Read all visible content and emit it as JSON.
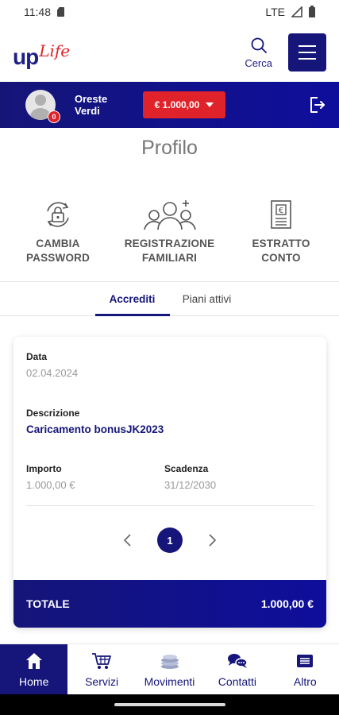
{
  "status_bar": {
    "time": "11:48",
    "network": "LTE"
  },
  "header": {
    "logo_up": "up",
    "logo_life": "Life",
    "search_label": "Cerca"
  },
  "user": {
    "first_name": "Oreste",
    "last_name": "Verdi",
    "notifications": "0",
    "balance": "€ 1.000,00"
  },
  "page_title": "Profilo",
  "actions": [
    {
      "line1": "CAMBIA",
      "line2": "PASSWORD",
      "icon": "lock-refresh-icon"
    },
    {
      "line1": "REGISTRAZIONE",
      "line2": "FAMILIARI",
      "icon": "family-add-icon"
    },
    {
      "line1": "ESTRATTO",
      "line2": "CONTO",
      "icon": "euro-document-icon"
    }
  ],
  "tabs": [
    {
      "label": "Accrediti",
      "active": true
    },
    {
      "label": "Piani attivi",
      "active": false
    }
  ],
  "card": {
    "date_label": "Data",
    "date_value": "02.04.2024",
    "description_label": "Descrizione",
    "description_value": "Caricamento bonusJK2023",
    "amount_label": "Importo",
    "amount_value": "1.000,00 €",
    "expiry_label": "Scadenza",
    "expiry_value": "31/12/2030",
    "current_page": "1",
    "total_label": "TOTALE",
    "total_value": "1.000,00 €"
  },
  "bottom_nav": [
    {
      "label": "Home",
      "icon": "home-icon",
      "active": true
    },
    {
      "label": "Servizi",
      "icon": "cart-icon",
      "active": false
    },
    {
      "label": "Movimenti",
      "icon": "coins-icon",
      "active": false
    },
    {
      "label": "Contatti",
      "icon": "chat-icon",
      "active": false
    },
    {
      "label": "Altro",
      "icon": "list-icon",
      "active": false
    }
  ],
  "colors": {
    "brand_blue": "#15157a",
    "brand_red": "#e0222a"
  }
}
